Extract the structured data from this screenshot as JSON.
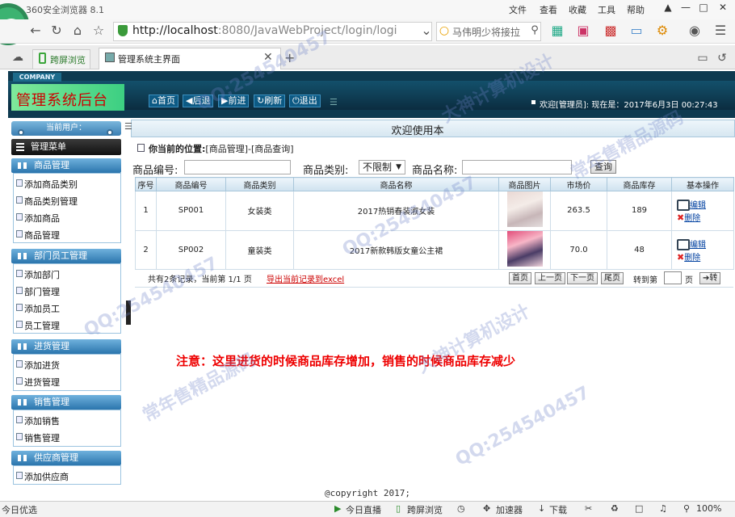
{
  "browser": {
    "title": "360安全浏览器 8.1",
    "menu": [
      "文件",
      "查看",
      "收藏",
      "工具",
      "帮助"
    ],
    "url_host": "http://localhost",
    "url_rest": ":8080/JavaWebProject/login/logi",
    "search_text": "马伟明少将接拉",
    "tabs": [
      {
        "label": "跨屏浏览"
      },
      {
        "label": "管理系统主界面"
      }
    ],
    "status": {
      "left": "今日优选",
      "live": "今日直播",
      "cross": "跨屏浏览",
      "accelerator": "加速器",
      "download": "下载",
      "zoom": "100%"
    }
  },
  "header": {
    "company": "COMPANY",
    "title": "管理系统后台",
    "nav": [
      {
        "label": "首页",
        "icon": "home-icon"
      },
      {
        "label": "后退",
        "icon": "back-icon"
      },
      {
        "label": "前进",
        "icon": "forward-icon"
      },
      {
        "label": "刷新",
        "icon": "refresh-icon"
      },
      {
        "label": "退出",
        "icon": "power-icon"
      }
    ],
    "welcome": "欢迎[管理员]:   现在是：2017年6月3日  00:27:43"
  },
  "sidebar": {
    "current_user": "当前用户：",
    "menu_title": "管理菜单",
    "sections": [
      {
        "title": "商品管理",
        "items": [
          "添加商品类别",
          "商品类别管理",
          "添加商品",
          "商品管理"
        ]
      },
      {
        "title": "部门员工管理",
        "items": [
          "添加部门",
          "部门管理",
          "添加员工",
          "员工管理"
        ]
      },
      {
        "title": "进货管理",
        "items": [
          "添加进货",
          "进货管理"
        ]
      },
      {
        "title": "销售管理",
        "items": [
          "添加销售",
          "销售管理"
        ]
      },
      {
        "title": "供应商管理",
        "items": [
          "添加供应商"
        ]
      }
    ]
  },
  "main": {
    "title": "欢迎使用本",
    "location_label": "你当前的位置:",
    "location_path": "[商品管理]-[商品查询]",
    "filters": {
      "code_label": "商品编号:",
      "type_label": "商品类别:",
      "type_value": "不限制",
      "name_label": "商品名称:",
      "query_button": "查询"
    },
    "table": {
      "headers": [
        "序号",
        "商品编号",
        "商品类别",
        "商品名称",
        "商品图片",
        "市场价",
        "商品库存",
        "基本操作"
      ],
      "rows": [
        {
          "no": "1",
          "code": "SP001",
          "type": "女装类",
          "name": "2017热销春装淑女装",
          "price": "263.5",
          "stock": "189"
        },
        {
          "no": "2",
          "code": "SP002",
          "type": "童装类",
          "name": "2017新款韩版女童公主裙",
          "price": "70.0",
          "stock": "48"
        }
      ],
      "edit_label": "编辑",
      "delete_label": "删除"
    },
    "pager": {
      "info": "共有2条记录，当前第 1/1 页",
      "export": "导出当前记录到excel",
      "first": "首页",
      "prev": "上一页",
      "next": "下一页",
      "last": "尾页",
      "jump_label": "转到第",
      "page_unit": "页",
      "go": "转"
    },
    "note": "注意：这里进货的时候商品库存增加，销售的时候商品库存减少"
  },
  "footer": {
    "copyright": "@copyright 2017;"
  },
  "watermarks": [
    "QQ:254540457",
    "大神计算机设计",
    "常年售精品源码"
  ]
}
